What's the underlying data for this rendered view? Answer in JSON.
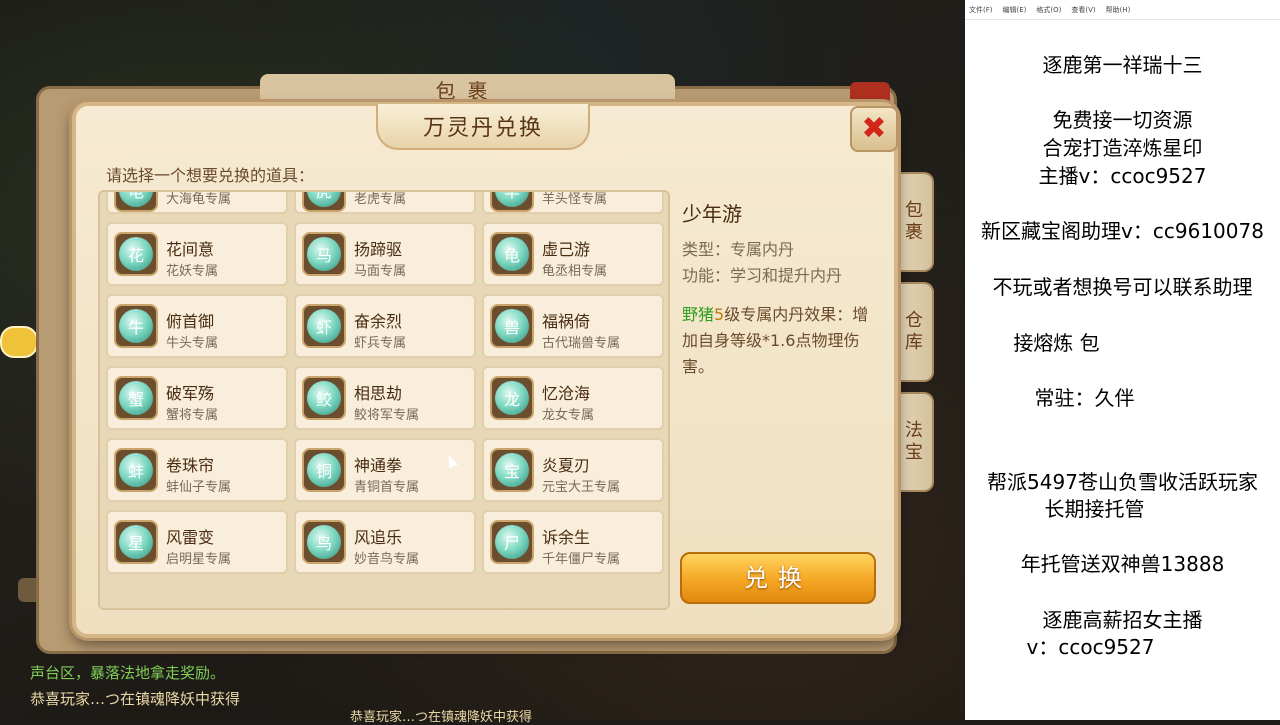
{
  "game": {
    "bag_title": "包裹",
    "side_tabs": [
      "包裹",
      "仓库",
      "法宝"
    ],
    "chat_lines": [
      "声台区，暴落法地拿走奖励。",
      "恭喜玩家…つ在镇魂降妖中获得",
      "恭喜玩家…つ在镇魂降妖中获得"
    ]
  },
  "dialog": {
    "title": "万灵丹兑换",
    "instruction": "请选择一个想要兑换的道具：",
    "items": [
      {
        "name": "",
        "sub": "大海龟专属",
        "glyph": "龟"
      },
      {
        "name": "",
        "sub": "老虎专属",
        "glyph": "虎"
      },
      {
        "name": "",
        "sub": "羊头怪专属",
        "glyph": "羊"
      },
      {
        "name": "花间意",
        "sub": "花妖专属",
        "glyph": "花"
      },
      {
        "name": "扬蹄驱",
        "sub": "马面专属",
        "glyph": "马"
      },
      {
        "name": "虚己游",
        "sub": "龟丞相专属",
        "glyph": "龟"
      },
      {
        "name": "俯首御",
        "sub": "牛头专属",
        "glyph": "牛"
      },
      {
        "name": "奋余烈",
        "sub": "虾兵专属",
        "glyph": "虾"
      },
      {
        "name": "福祸倚",
        "sub": "古代瑞兽专属",
        "glyph": "兽"
      },
      {
        "name": "破军殇",
        "sub": "蟹将专属",
        "glyph": "蟹"
      },
      {
        "name": "相思劫",
        "sub": "鲛将军专属",
        "glyph": "鲛"
      },
      {
        "name": "忆沧海",
        "sub": "龙女专属",
        "glyph": "龙"
      },
      {
        "name": "卷珠帘",
        "sub": "蚌仙子专属",
        "glyph": "蚌"
      },
      {
        "name": "神通拳",
        "sub": "青铜首专属",
        "glyph": "铜"
      },
      {
        "name": "炎夏刃",
        "sub": "元宝大王专属",
        "glyph": "宝"
      },
      {
        "name": "风雷变",
        "sub": "启明星专属",
        "glyph": "星"
      },
      {
        "name": "风追乐",
        "sub": "妙音鸟专属",
        "glyph": "鸟"
      },
      {
        "name": "诉余生",
        "sub": "千年僵尸专属",
        "glyph": "尸"
      }
    ],
    "detail": {
      "name": "少年游",
      "type_line": "类型：专属内丹",
      "func_line": "功能：学习和提升内丹",
      "effect_pet": "野猪",
      "effect_level": "5",
      "effect_rest": "级专属内丹效果：增加自身等级*1.6点物理伤害。"
    },
    "exchange_label": "兑换"
  },
  "notepad": {
    "menu": [
      "文件(F)",
      "编辑(E)",
      "格式(O)",
      "查看(V)",
      "帮助(H)"
    ],
    "lines": [
      "逐鹿第一祥瑞十三",
      "免费接一切资源",
      "合宠打造淬炼星印",
      "主播v：ccoc9527",
      "新区藏宝阁助理v：cc9610078",
      "不玩或者想换号可以联系助理",
      "接熔炼 包",
      "常驻：久伴",
      "帮派5497苍山负雪收活跃玩家",
      "长期接托管",
      "年托管送双神兽13888",
      "逐鹿高薪招女主播",
      "v：ccoc9527"
    ]
  }
}
